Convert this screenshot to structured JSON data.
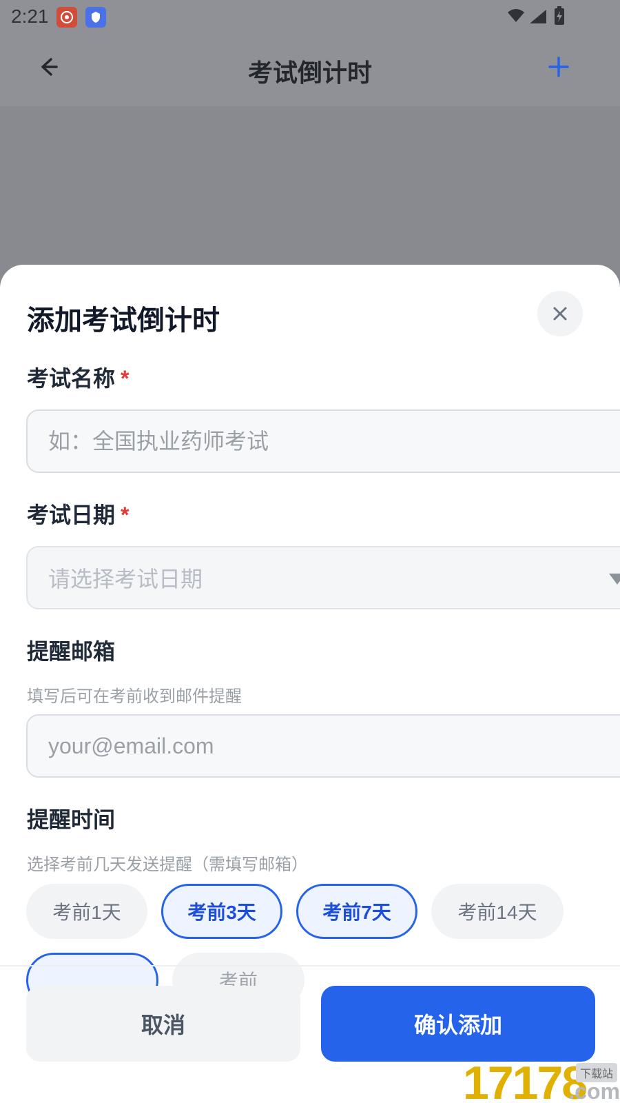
{
  "status_bar": {
    "time": "2:21",
    "app_icons": [
      "weibo-icon",
      "shield-app-icon"
    ],
    "status_icons": [
      "wifi-icon",
      "signal-icon",
      "battery-charging-icon"
    ]
  },
  "header": {
    "title": "考试倒计时",
    "back_icon": "back-arrow-icon",
    "add_icon": "plus-icon",
    "accent_color": "#2563EB"
  },
  "sheet": {
    "title": "添加考试倒计时",
    "close_icon": "close-icon",
    "exam_name": {
      "label": "考试名称",
      "required_mark": "*",
      "placeholder": "如：全国执业药师考试"
    },
    "exam_date": {
      "label": "考试日期",
      "required_mark": "*",
      "placeholder": "请选择考试日期"
    },
    "reminder_email": {
      "label": "提醒邮箱",
      "helper": "填写后可在考前收到邮件提醒",
      "placeholder": "your@email.com"
    },
    "reminder_time": {
      "label": "提醒时间",
      "helper": "选择考前几天发送提醒（需填写邮箱）",
      "options": [
        {
          "label": "考前1天",
          "selected": false
        },
        {
          "label": "考前3天",
          "selected": true
        },
        {
          "label": "考前7天",
          "selected": true
        },
        {
          "label": "考前14天",
          "selected": false
        },
        {
          "label": "",
          "selected": true
        },
        {
          "label": "考前",
          "selected": false
        }
      ]
    },
    "buttons": {
      "cancel": "取消",
      "confirm": "确认添加"
    }
  },
  "watermark": {
    "number": "17178",
    "suffix": ".com",
    "tag": "下载站"
  },
  "colors": {
    "primary": "#2563EB",
    "required": "#E53935",
    "overlay": "#888A8F"
  }
}
